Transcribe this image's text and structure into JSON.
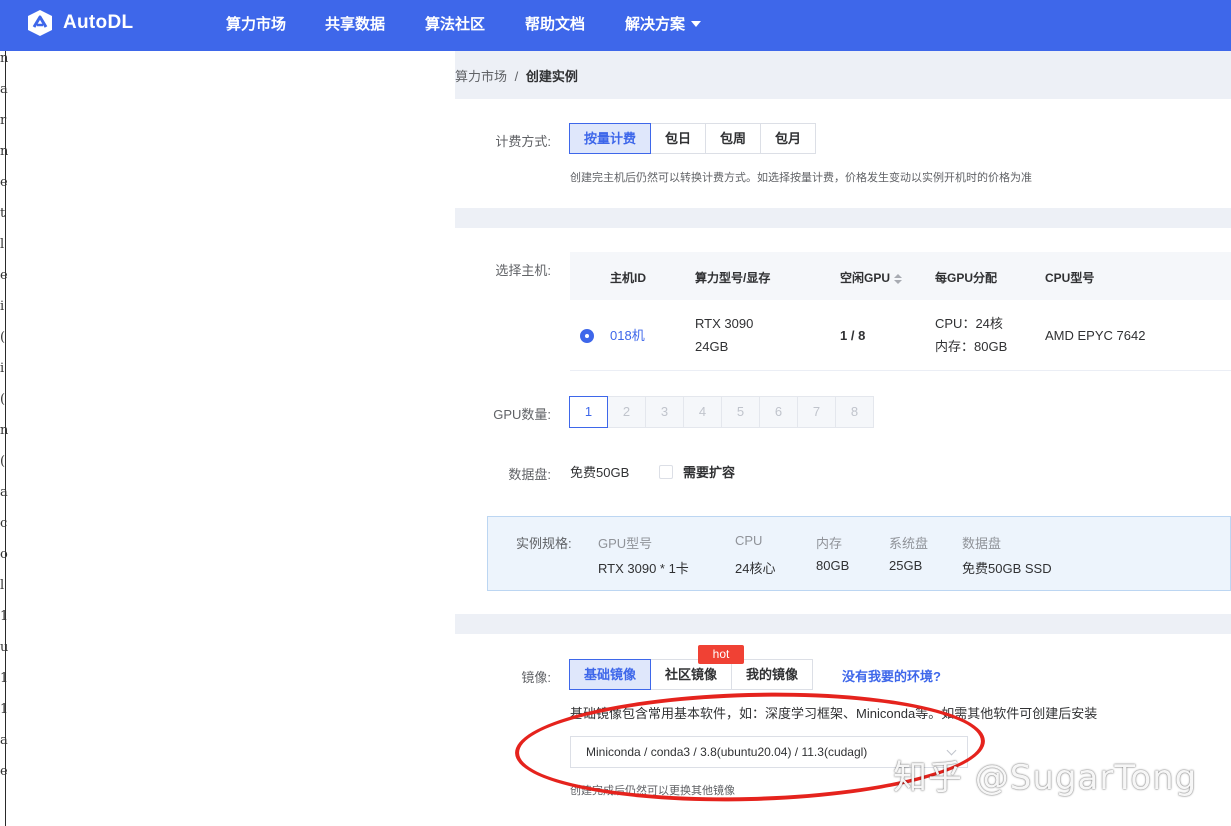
{
  "brand": {
    "name": "AutoDL",
    "color": "#3e67ea"
  },
  "nav": {
    "items": [
      "算力市场",
      "共享数据",
      "算法社区",
      "帮助文档",
      "解决方案"
    ]
  },
  "left_edge_glyphs": [
    "n",
    "a",
    "r",
    "n",
    "e",
    "t",
    "l",
    "e",
    "i",
    "(",
    "i",
    "(",
    "n",
    "(",
    "a",
    "c",
    "o",
    "l",
    "1",
    "u",
    "1",
    "1",
    "a",
    "e"
  ],
  "breadcrumb": {
    "parent": "算力市场",
    "separator": "/",
    "current": "创建实例"
  },
  "billing": {
    "label": "计费方式:",
    "options": [
      "按量计费",
      "包日",
      "包周",
      "包月"
    ],
    "selected": "按量计费",
    "hint": "创建完主机后仍然可以转换计费方式。如选择按量计费，价格发生变动以实例开机时的价格为准"
  },
  "host": {
    "label": "选择主机:",
    "columns": [
      "主机ID",
      "算力型号/显存",
      "空闲GPU",
      "每GPU分配",
      "CPU型号"
    ],
    "rows": [
      {
        "id": "018机",
        "model": "RTX 3090",
        "vram": "24GB",
        "free_gpu": "1 / 8",
        "cpu_alloc": "CPU：24核",
        "mem_alloc": "内存：80GB",
        "cpu_model": "AMD EPYC 7642",
        "selected": true
      }
    ]
  },
  "gpu_count": {
    "label": "GPU数量:",
    "options": [
      "1",
      "2",
      "3",
      "4",
      "5",
      "6",
      "7",
      "8"
    ],
    "selected": "1"
  },
  "data_disk": {
    "label": "数据盘:",
    "value": "免费50GB",
    "expand_label": "需要扩容",
    "expand_checked": false
  },
  "spec": {
    "label": "实例规格:",
    "headers": [
      "GPU型号",
      "CPU",
      "内存",
      "系统盘",
      "数据盘"
    ],
    "values": [
      "RTX 3090 * 1卡",
      "24核心",
      "80GB",
      "25GB",
      "免费50GB SSD"
    ]
  },
  "image": {
    "label": "镜像:",
    "tabs": [
      "基础镜像",
      "社区镜像",
      "我的镜像"
    ],
    "selected_tab": "基础镜像",
    "hot_badge": "hot",
    "missing_link": "没有我要的环境?",
    "hint": "基础镜像包含常用基本软件，如：深度学习框架、Miniconda等。如需其他软件可创建后安装",
    "select_value": "Miniconda / conda3 / 3.8(ubuntu20.04) / 11.3(cudagl)",
    "after_hint": "创建完成后仍然可以更换其他镜像"
  },
  "annotation": {
    "color": "#e5231d"
  },
  "watermark": "知乎 @SugarTong"
}
